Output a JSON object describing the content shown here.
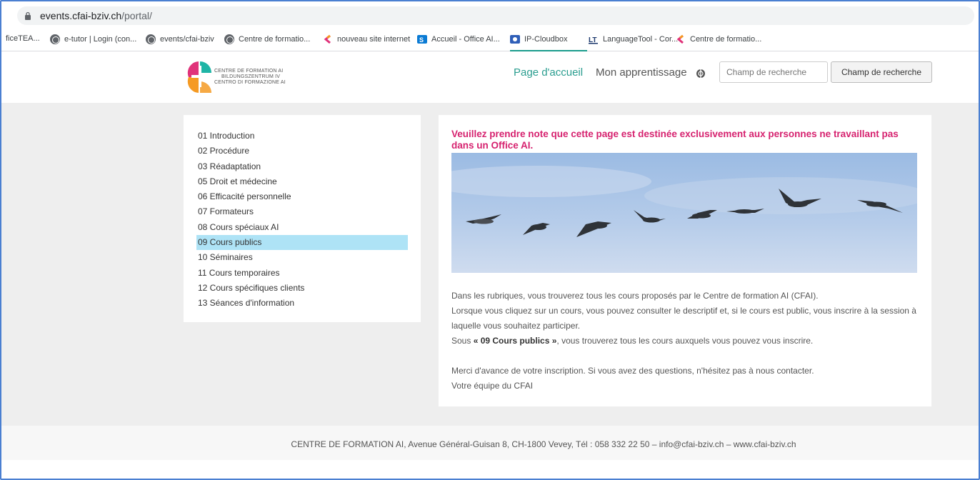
{
  "browser": {
    "url_host": "events.cfai-bziv.ch",
    "url_path": "/portal/"
  },
  "bookmarks": [
    {
      "label": "ficeTEA...",
      "icon": "none"
    },
    {
      "label": "e-tutor | Login (con...",
      "icon": "globe-icon"
    },
    {
      "label": "events/cfai-bziv",
      "icon": "globe-icon"
    },
    {
      "label": "Centre de formatio...",
      "icon": "globe-icon"
    },
    {
      "label": "nouveau site internet",
      "icon": "brand-c-icon"
    },
    {
      "label": "Accueil - Office AI...",
      "icon": "sharepoint-icon"
    },
    {
      "label": "IP-Cloudbox",
      "icon": "cloudbox-icon"
    },
    {
      "label": "LanguageTool - Cor...",
      "icon": "languagetool-icon"
    },
    {
      "label": "Centre de formatio...",
      "icon": "brand-c-icon"
    }
  ],
  "header": {
    "logo_lines": [
      "CENTRE DE FORMATION AI",
      "BILDUNGSZENTRUM IV",
      "CENTRO DI FORMAZIONE AI"
    ],
    "nav_home": "Page d'accueil",
    "nav_learning": "Mon apprentissage",
    "search_placeholder": "Champ de recherche",
    "search_button": "Champ de recherche"
  },
  "sidebar": {
    "items": [
      {
        "label": "01 Introduction"
      },
      {
        "label": "02 Procédure"
      },
      {
        "label": "03 Réadaptation"
      },
      {
        "label": "05 Droit et médecine"
      },
      {
        "label": "06 Efficacité personnelle"
      },
      {
        "label": "07 Formateurs"
      },
      {
        "label": "08 Cours spéciaux AI"
      },
      {
        "label": "09 Cours publics"
      },
      {
        "label": "10 Séminaires"
      },
      {
        "label": "11 Cours temporaires"
      },
      {
        "label": "12 Cours spécifiques clients"
      },
      {
        "label": "13 Séances d'information"
      }
    ],
    "active_item": "09 Cours publics"
  },
  "content": {
    "notice": "Veuillez prendre note que cette page est destinée exclusivement aux personnes ne travaillant pas dans un Office AI.",
    "paragraph1": "Dans les rubriques, vous trouverez tous les cours proposés par le Centre de formation AI (CFAI).",
    "paragraph2": "Lorsque vous cliquez sur un cours, vous pouvez consulter le descriptif et, si le cours est public, vous inscrire à la session à laquelle vous souhaitez participer.",
    "paragraph3_before": "Sous ",
    "paragraph3_bold": "« 09 Cours publics »",
    "paragraph3_after": ", vous trouverez tous les cours auxquels vous pouvez vous inscrire.",
    "paragraph4": "Merci d'avance de votre inscription. Si vous avez des questions, n'hésitez pas à nous contacter.",
    "signature": "Votre équipe du CFAI"
  },
  "footer": {
    "text": "CENTRE DE FORMATION AI, Avenue Général-Guisan 8, CH-1800 Vevey, Tél : 058 332 22 50 – info@cfai-bziv.ch – www.cfai-bziv.ch"
  },
  "colors": {
    "accent_teal": "#2a9d8f",
    "notice_magenta": "#d6226f",
    "active_item_bg": "#aee3f6",
    "page_bg": "#eeeeee"
  }
}
